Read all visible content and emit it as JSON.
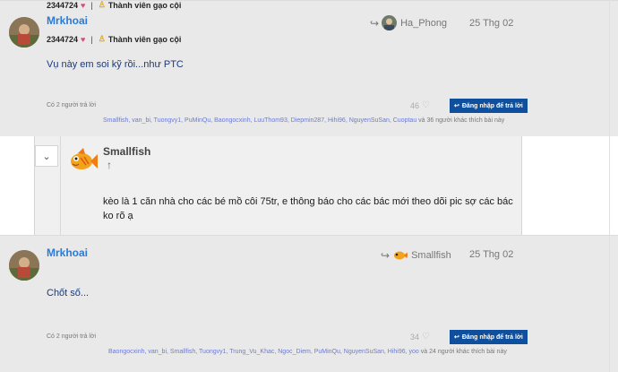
{
  "posts": [
    {
      "username": "Mrkhoai",
      "likes_total": "2344724",
      "title": "Thành viên gạo cội",
      "reply_to_user": "Ha_Phong",
      "date": "25 Thg 02",
      "body": "Vụ này em soi kỹ rồi...như PTC",
      "replies": "Có 2 người trả lời",
      "like_count": "46",
      "reply_button": "Đăng nhập để trả lời",
      "likers_names": "Smallfish, van_bi, Tuongvy1, PuMinQu, Baongocxinh, LuuThom93, Diepmin287, Hihi96, NguyenSuSan, Cuoptau",
      "likers_rest": "và 36 người khác thích bài này"
    },
    {
      "username": "Mrkhoai",
      "likes_total": "2344724",
      "title": "Thành viên gạo cội",
      "reply_to_user": "Smallfish",
      "date": "25 Thg 02",
      "body": "Chốt số...",
      "replies": "Có 2 người trả lời",
      "like_count": "34",
      "reply_button": "Đăng nhập để trả lời",
      "likers_names": "Baongocxinh, van_bi, Smallfish, Tuongvy1, Trung_Vu_Khac, Ngoc_Diem, PuMinQu, NguyenSuSan, Hihi96, yoo",
      "likers_rest": "và 24 người khác thích bài này"
    }
  ],
  "quote": {
    "username": "Smallfish",
    "body": "kèo là 1 căn nhà cho các bé mồ côi 75tr, e thông báo cho các bác mới theo dõi pic sợ các bác ko rõ ạ"
  },
  "colors": {
    "username": "#2a7bd6",
    "button": "#0e4f9e",
    "heart": "#e0457b",
    "likers": "#6b7bd6"
  },
  "icons": [
    "heart-icon",
    "medal-icon",
    "reply-arrow-icon",
    "like-heart-icon",
    "chevron-down-icon",
    "arrow-up-icon"
  ]
}
